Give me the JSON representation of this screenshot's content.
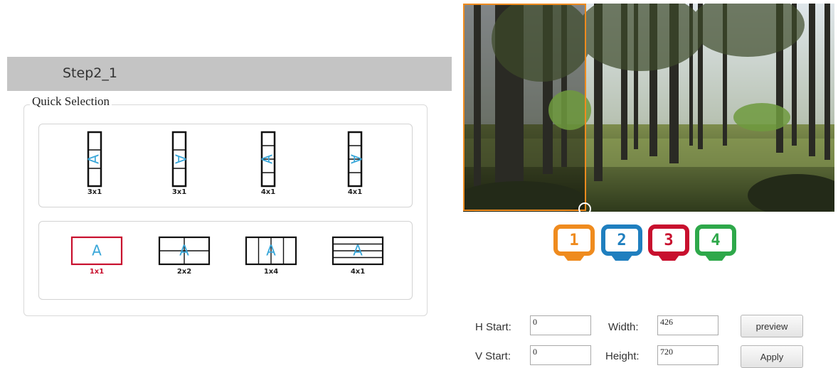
{
  "step": {
    "title": "Step2_1"
  },
  "quick_selection": {
    "legend": "Quick Selection",
    "rotated_layouts": [
      {
        "label": "3x1",
        "glyph": "A",
        "rotation": "left"
      },
      {
        "label": "3x1",
        "glyph": "A",
        "rotation": "right"
      },
      {
        "label": "4x1",
        "glyph": "A",
        "rotation": "left"
      },
      {
        "label": "4x1",
        "glyph": "A",
        "rotation": "right"
      }
    ],
    "normal_layouts": [
      {
        "label": "1x1",
        "glyph": "A",
        "selected": true
      },
      {
        "label": "2x2",
        "glyph": "A",
        "selected": false
      },
      {
        "label": "1x4",
        "glyph": "A",
        "selected": false
      },
      {
        "label": "4x1",
        "glyph": "A",
        "selected": false
      }
    ]
  },
  "monitors": [
    {
      "number": "1",
      "color": "#ef8b1e"
    },
    {
      "number": "2",
      "color": "#1f7fbf"
    },
    {
      "number": "3",
      "color": "#c8102e"
    },
    {
      "number": "4",
      "color": "#2ea84a"
    }
  ],
  "fields": {
    "h_start_label": "H Start:",
    "h_start_value": "0",
    "v_start_label": "V Start:",
    "v_start_value": "0",
    "width_label": "Width:",
    "width_value": "426",
    "height_label": "Height:",
    "height_value": "720"
  },
  "buttons": {
    "preview": "preview",
    "apply": "Apply"
  },
  "colors": {
    "selection": "#ef8b1e",
    "accent_blue": "#3aa7d9",
    "active_red": "#c8102e"
  }
}
